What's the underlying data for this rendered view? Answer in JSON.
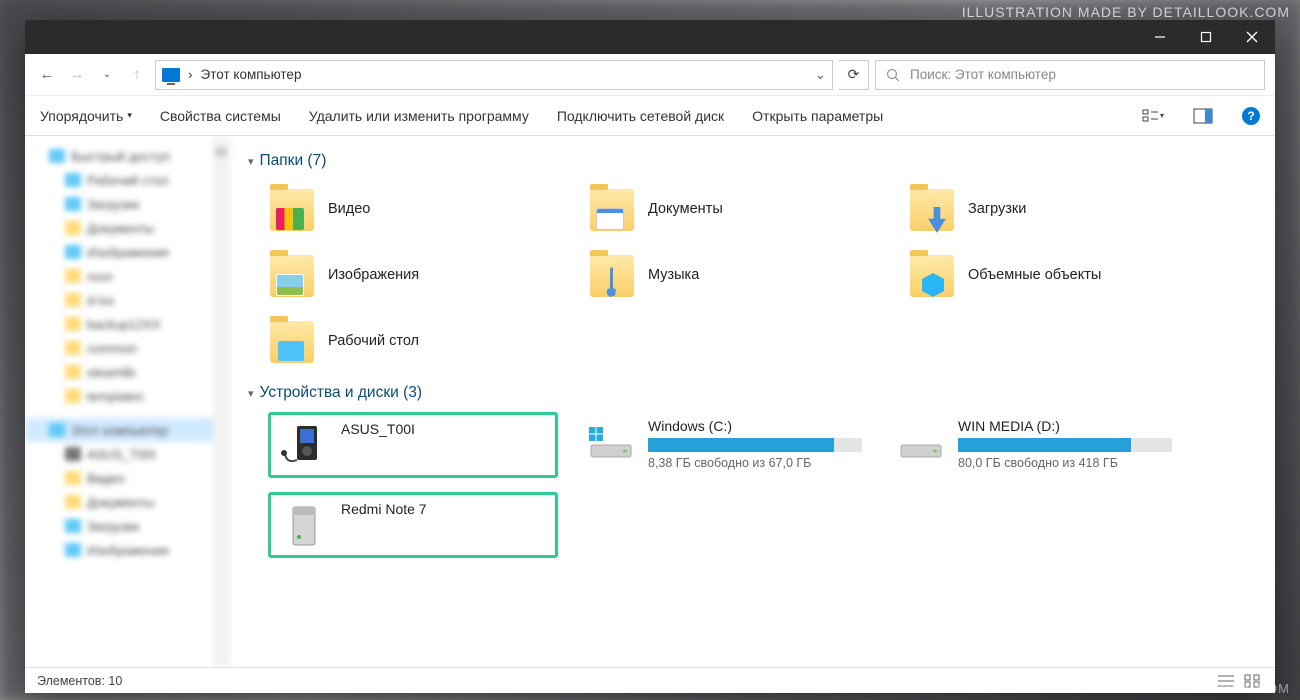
{
  "watermark": "ILLUSTRATION MADE BY DETAILLOOK.COM",
  "breadcrumb": {
    "root_label": "Этот компьютер"
  },
  "search": {
    "placeholder": "Поиск: Этот компьютер"
  },
  "toolbar": {
    "organize": "Упорядочить",
    "props": "Свойства системы",
    "uninstall": "Удалить или изменить программу",
    "mapdrive": "Подключить сетевой диск",
    "settings": "Открыть параметры"
  },
  "sections": {
    "folders_title": "Папки (7)",
    "drives_title": "Устройства и диски (3)"
  },
  "folders": [
    {
      "label": "Видео"
    },
    {
      "label": "Документы"
    },
    {
      "label": "Загрузки"
    },
    {
      "label": "Изображения"
    },
    {
      "label": "Музыка"
    },
    {
      "label": "Объемные объекты"
    },
    {
      "label": "Рабочий стол"
    }
  ],
  "drives": {
    "asus": {
      "label": "ASUS_T00I"
    },
    "c": {
      "label": "Windows (C:)",
      "sub": "8,38 ГБ свободно из 67,0 ГБ",
      "fill": 87
    },
    "d": {
      "label": "WIN MEDIA (D:)",
      "sub": "80,0 ГБ свободно из 418 ГБ",
      "fill": 81
    },
    "redmi": {
      "label": "Redmi Note 7"
    }
  },
  "status": {
    "items": "Элементов: 10"
  }
}
